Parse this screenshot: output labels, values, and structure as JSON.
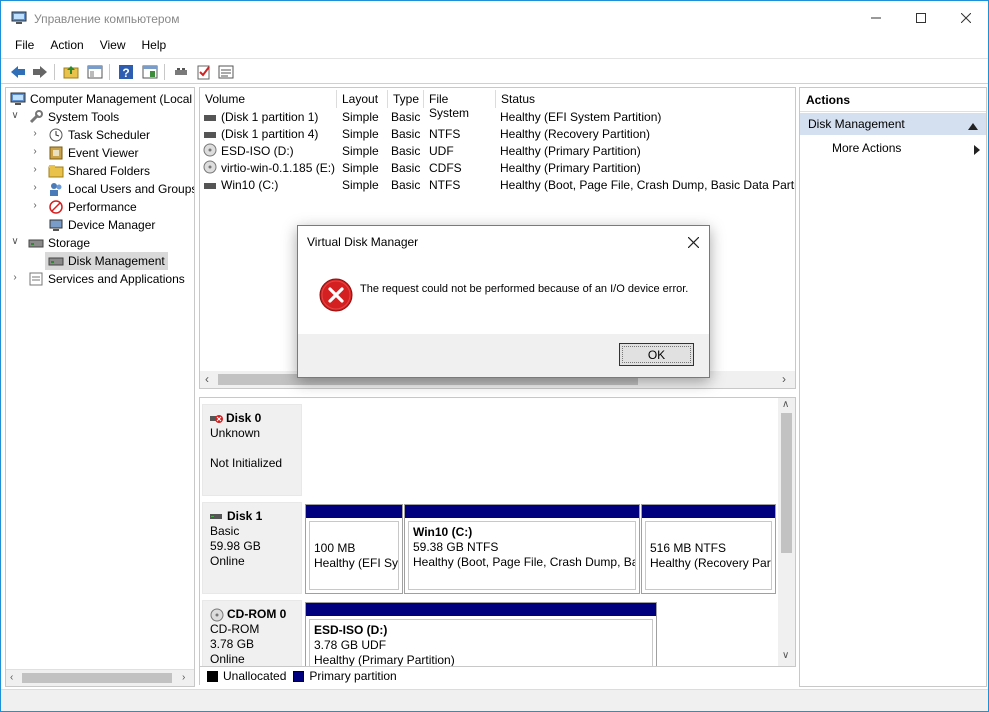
{
  "window": {
    "title": "Управление компьютером"
  },
  "menu": [
    "File",
    "Action",
    "View",
    "Help"
  ],
  "toolbar_icons": [
    "back-arrow-icon",
    "forward-arrow-icon",
    "up-folder-icon",
    "show-hide-tree-icon",
    "help-icon",
    "properties-icon",
    "connect-icon",
    "checklist-icon",
    "list-icon"
  ],
  "tree": {
    "root": "Computer Management (Local",
    "system_tools": "System Tools",
    "task_scheduler": "Task Scheduler",
    "event_viewer": "Event Viewer",
    "shared_folders": "Shared Folders",
    "local_users": "Local Users and Groups",
    "performance": "Performance",
    "device_manager": "Device Manager",
    "storage": "Storage",
    "disk_management": "Disk Management",
    "services": "Services and Applications"
  },
  "volumes": {
    "headers": [
      "Volume",
      "Layout",
      "Type",
      "File System",
      "Status"
    ],
    "rows": [
      {
        "volume": "(Disk 1 partition 1)",
        "layout": "Simple",
        "type": "Basic",
        "fs": "",
        "status": "Healthy (EFI System Partition)"
      },
      {
        "volume": "(Disk 1 partition 4)",
        "layout": "Simple",
        "type": "Basic",
        "fs": "NTFS",
        "status": "Healthy (Recovery Partition)"
      },
      {
        "volume": "ESD-ISO (D:)",
        "layout": "Simple",
        "type": "Basic",
        "fs": "UDF",
        "status": "Healthy (Primary Partition)"
      },
      {
        "volume": "virtio-win-0.1.185 (E:)",
        "layout": "Simple",
        "type": "Basic",
        "fs": "CDFS",
        "status": "Healthy (Primary Partition)"
      },
      {
        "volume": "Win10 (C:)",
        "layout": "Simple",
        "type": "Basic",
        "fs": "NTFS",
        "status": "Healthy (Boot, Page File, Crash Dump, Basic Data Partiti"
      }
    ]
  },
  "disks": {
    "disk0": {
      "name": "Disk 0",
      "type": "Unknown",
      "state": "Not Initialized"
    },
    "disk1": {
      "name": "Disk 1",
      "type": "Basic",
      "size": "59.98 GB",
      "state": "Online",
      "p1": {
        "size": "100 MB",
        "status": "Healthy (EFI Sys"
      },
      "p2": {
        "label": "Win10  (C:)",
        "size": "59.38 GB NTFS",
        "status": "Healthy (Boot, Page File, Crash Dump, Bas"
      },
      "p3": {
        "size": "516 MB NTFS",
        "status": "Healthy (Recovery Part"
      }
    },
    "cdrom0": {
      "name": "CD-ROM 0",
      "type": "CD-ROM",
      "size": "3.78 GB",
      "state": "Online",
      "p1": {
        "label": "ESD-ISO  (D:)",
        "size": "3.78 GB UDF",
        "status": "Healthy (Primary Partition)"
      }
    }
  },
  "legend": {
    "unallocated": "Unallocated",
    "primary": "Primary partition",
    "unallocated_color": "#000000",
    "primary_color": "#00007f"
  },
  "actions": {
    "title": "Actions",
    "section": "Disk Management",
    "more": "More Actions"
  },
  "dialog": {
    "title": "Virtual Disk Manager",
    "message": "The request could not be performed because of an I/O device error.",
    "ok": "OK",
    "icon": "error-icon"
  },
  "colors": {
    "partition_bar": "#00007f",
    "selected_section": "#d4dfef",
    "error_red": "#d42020"
  }
}
